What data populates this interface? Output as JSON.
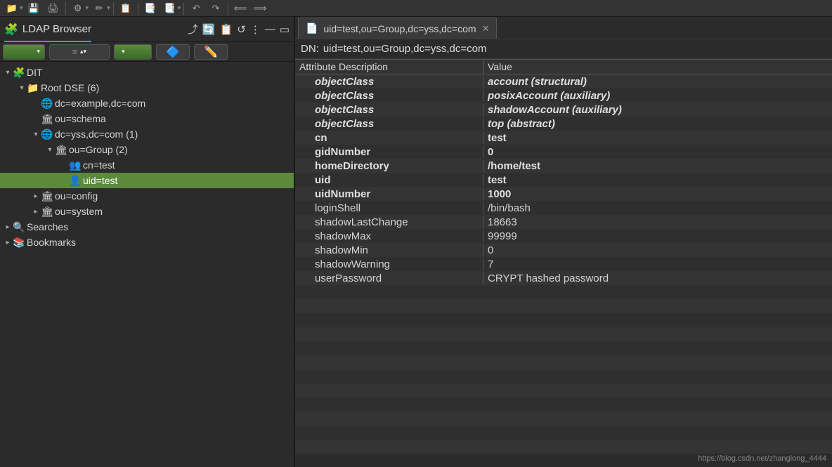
{
  "topbar_icons": [
    "📁",
    "💾",
    "🖨",
    "⚙",
    "✏",
    "📋",
    "📑",
    "📑",
    "↶",
    "↷",
    "⟸",
    "⟹"
  ],
  "left": {
    "title": "LDAP Browser",
    "header_actions": [
      "⤴",
      "🔄",
      "📋",
      "↺",
      "⋮",
      "—",
      "▭"
    ],
    "filter_eq": "=",
    "tree": [
      {
        "ind": 0,
        "exp": "v",
        "icon": "🧩",
        "label": "DIT"
      },
      {
        "ind": 1,
        "exp": "v",
        "icon": "📁",
        "label": "Root DSE (6)"
      },
      {
        "ind": 2,
        "exp": "",
        "icon": "🌐",
        "label": "dc=example,dc=com"
      },
      {
        "ind": 2,
        "exp": "",
        "icon": "🏛",
        "label": "ou=schema"
      },
      {
        "ind": 2,
        "exp": "v",
        "icon": "🌐",
        "label": "dc=yss,dc=com (1)"
      },
      {
        "ind": 3,
        "exp": "v",
        "icon": "🏛",
        "label": "ou=Group (2)"
      },
      {
        "ind": 4,
        "exp": "",
        "icon": "👥",
        "label": "cn=test"
      },
      {
        "ind": 4,
        "exp": "",
        "icon": "👤",
        "label": "uid=test",
        "selected": true
      },
      {
        "ind": 2,
        "exp": ">",
        "icon": "🏛",
        "label": "ou=config"
      },
      {
        "ind": 2,
        "exp": ">",
        "icon": "🏛",
        "label": "ou=system"
      },
      {
        "ind": 0,
        "exp": ">",
        "icon": "🔍",
        "label": "Searches"
      },
      {
        "ind": 0,
        "exp": ">",
        "icon": "📚",
        "label": "Bookmarks"
      }
    ]
  },
  "right": {
    "tab_icon": "📄",
    "tab_title": "uid=test,ou=Group,dc=yss,dc=com",
    "dn_label": "DN:",
    "dn_value": "uid=test,ou=Group,dc=yss,dc=com",
    "head_attr": "Attribute Description",
    "head_val": "Value",
    "rows": [
      {
        "a": "objectClass",
        "v": "account (structural)",
        "b": true
      },
      {
        "a": "objectClass",
        "v": "posixAccount (auxiliary)",
        "b": true
      },
      {
        "a": "objectClass",
        "v": "shadowAccount (auxiliary)",
        "b": true
      },
      {
        "a": "objectClass",
        "v": "top (abstract)",
        "b": true
      },
      {
        "a": "cn",
        "v": "test",
        "bo": true
      },
      {
        "a": "gidNumber",
        "v": "0",
        "bo": true
      },
      {
        "a": "homeDirectory",
        "v": "/home/test",
        "bo": true
      },
      {
        "a": "uid",
        "v": "test",
        "bo": true
      },
      {
        "a": "uidNumber",
        "v": "1000",
        "bo": true
      },
      {
        "a": "loginShell",
        "v": "/bin/bash"
      },
      {
        "a": "shadowLastChange",
        "v": "18663"
      },
      {
        "a": "shadowMax",
        "v": "99999"
      },
      {
        "a": "shadowMin",
        "v": "0"
      },
      {
        "a": "shadowWarning",
        "v": "7"
      },
      {
        "a": "userPassword",
        "v": "CRYPT hashed password"
      }
    ],
    "empty_rows": 12
  },
  "watermark": "https://blog.csdn.net/zhanglong_4444"
}
